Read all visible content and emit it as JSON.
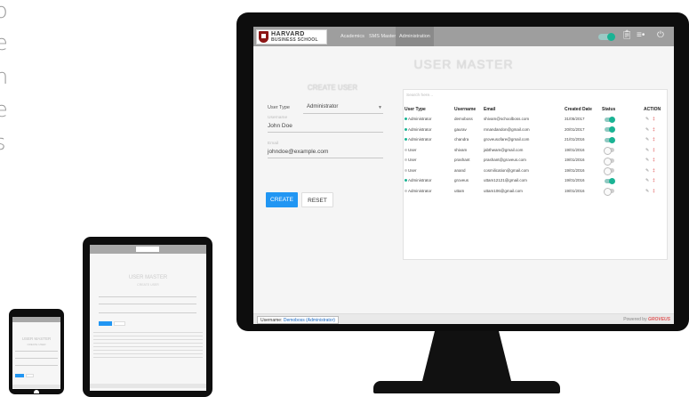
{
  "left_text": [
    "o",
    "e",
    "n",
    "e",
    "s"
  ],
  "header": {
    "logo_line1": "HARVARD",
    "logo_line2": "BUSINESS SCHOOL",
    "nav": [
      "Academics",
      "SMS Master",
      "Administration"
    ],
    "active_nav": "Administration",
    "icons": [
      "toggle-switch",
      "clipboard-icon",
      "menu-icon",
      "power-icon"
    ]
  },
  "page_title": "USER MASTER",
  "create_form": {
    "title": "CREATE USER",
    "user_type_label": "User Type",
    "user_type_value": "Administrator",
    "username_label": "Username",
    "username_value": "John Doe",
    "email_label": "Email",
    "email_value": "johndoe@example.com",
    "create_button": "CREATE",
    "reset_button": "RESET"
  },
  "table": {
    "search_placeholder": "Search here...",
    "columns": [
      "User Type",
      "Username",
      "Email",
      "Created Date",
      "Status",
      "ACTION"
    ],
    "rows": [
      {
        "type": "Administrator",
        "username": "demoboss",
        "email": "shivam@schoolboss.com",
        "date": "31/05/2017",
        "status": "on"
      },
      {
        "type": "Administrator",
        "username": "gaurav",
        "email": "rnnandandon@gmail.com",
        "date": "20/01/2017",
        "status": "on"
      },
      {
        "type": "Administrator",
        "username": "chandra",
        "email": "groveusofare@gmail.com",
        "date": "21/01/2016",
        "status": "on"
      },
      {
        "type": "User",
        "username": "shivam",
        "email": "jabthwam@gmail.com",
        "date": "19/01/2016",
        "status": "off"
      },
      {
        "type": "User",
        "username": "prashant",
        "email": "prashant@groveus.com",
        "date": "19/01/2016",
        "status": "off"
      },
      {
        "type": "User",
        "username": "anand",
        "email": "cosmilication@gmail.com",
        "date": "19/01/2016",
        "status": "off"
      },
      {
        "type": "Administrator",
        "username": "groveus",
        "email": "uttam12121@gmail.com",
        "date": "19/01/2016",
        "status": "on"
      },
      {
        "type": "Administrator",
        "username": "uttam",
        "email": "uttam106@gmail.com",
        "date": "19/01/2016",
        "status": "off"
      }
    ],
    "edit_icon": "pencil-icon",
    "delete_icon": "trash-icon"
  },
  "status_bar": {
    "label": "Username: ",
    "user": "Demoboss (Administrator)",
    "powered_label": "Powered by",
    "brand": "GROVEUS"
  },
  "tablet": {
    "title": "USER MASTER",
    "subtitle": "CREATE USER",
    "buttons": [
      "CREATE",
      "RESET"
    ]
  },
  "phone": {
    "title": "USER MASTER",
    "subtitle": "CREATE USER",
    "buttons": [
      "CREATE",
      "RESET"
    ]
  },
  "colors": {
    "accent": "#2196f3",
    "toggle_on": "#1ab394",
    "delete": "#e05a5a",
    "header": "#9e9e9e",
    "device": "#0d0d0d"
  }
}
